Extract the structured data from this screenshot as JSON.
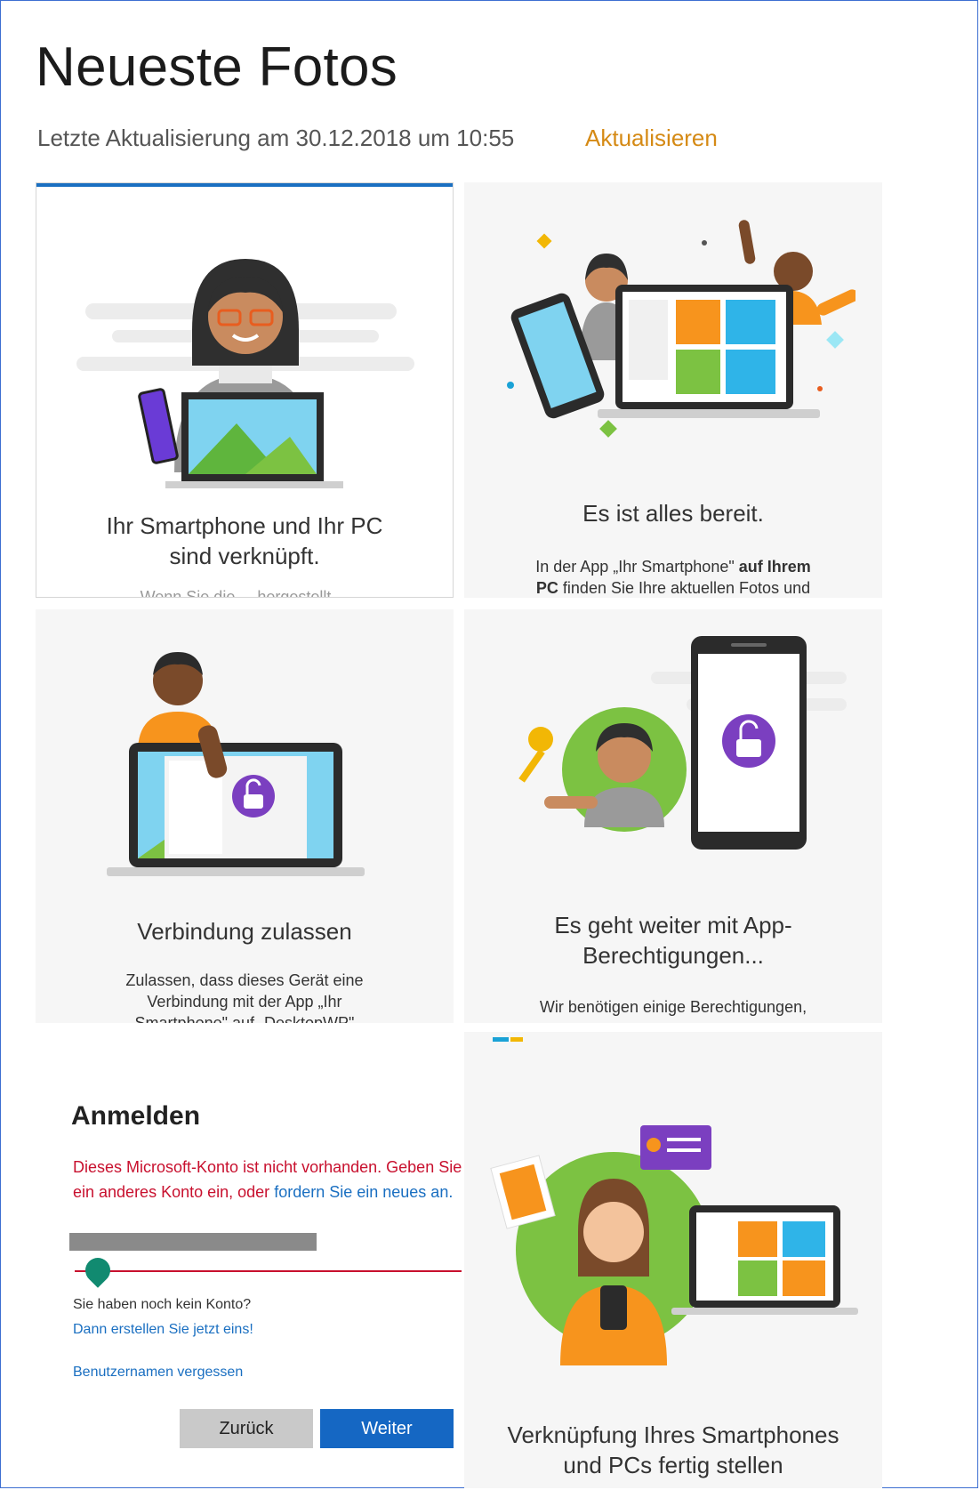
{
  "header": {
    "title": "Neueste Fotos",
    "last_update": "Letzte Aktualisierung am 30.12.2018 um 10:55",
    "refresh_link": "Aktualisieren"
  },
  "cards": [
    {
      "title": "Ihr Smartphone und Ihr PC sind verknüpft.",
      "cut_text": "Wenn Sie die ... hergestellt ..."
    },
    {
      "title": "Es ist alles bereit.",
      "desc_1": "In der App „Ihr Smartphone\"",
      "desc_1_bold": "auf Ihrem",
      "desc_2_bold": "PC",
      "desc_2": "finden Sie Ihre aktuellen Fotos und"
    },
    {
      "title": "Verbindung zulassen",
      "desc": "Zulassen, dass dieses Gerät eine Verbindung mit der App „Ihr Smartphone\" auf „DesktopWP\" herstellt"
    },
    {
      "title": "Es geht weiter mit App-Berechtigungen...",
      "desc": "Wir benötigen einige Berechtigungen,"
    },
    {
      "title": "Verknüpfung Ihres Smartphones und PCs fertig stellen"
    }
  ],
  "signin": {
    "title": "Anmelden",
    "error_text": "Dieses Microsoft-Konto ist nicht vorhanden. Geben Sie ein anderes Konto ein, oder",
    "error_link": "fordern Sie ein neues an.",
    "no_account": "Sie haben noch kein Konto?",
    "create_link": "Dann erstellen Sie jetzt eins!",
    "forgot_link": "Benutzernamen vergessen",
    "back_button": "Zurück",
    "next_button": "Weiter"
  },
  "colors": {
    "accent_blue": "#1a6fc1",
    "refresh_orange": "#d58a15",
    "error_red": "#c8102e",
    "green": "#7cc242",
    "purple": "#7b3fc0",
    "orange": "#f7941d"
  }
}
